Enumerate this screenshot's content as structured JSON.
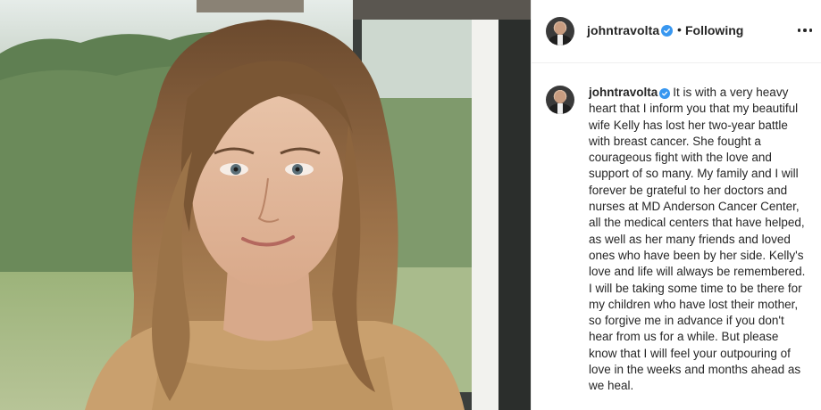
{
  "post": {
    "photo": {
      "subject": "portrait-photo"
    },
    "header": {
      "username": "johntravolta",
      "verified": true,
      "separator": "•",
      "follow_label": "Following",
      "more_icon": "more-options-icon"
    },
    "caption": {
      "username": "johntravolta",
      "verified": true,
      "text": "It is with a very heavy heart that I inform you that my beautiful wife Kelly has lost her two-year battle with breast cancer. She fought a courageous fight with the love and support of so many.  My family and I will forever be grateful to her doctors and nurses at MD Anderson Cancer Center, all the medical centers that have helped, as well as her many friends and loved ones who have been by her side. Kelly's love and life will always be remembered. I will be taking some time to be there for my children who have lost their mother, so forgive me in advance if you don't hear from us for a while.  But please know that I will feel your outpouring of love in the weeks and months ahead as we heal."
    }
  },
  "colors": {
    "verified_badge": "#3897f0",
    "text": "#262626",
    "divider": "#efefef"
  }
}
